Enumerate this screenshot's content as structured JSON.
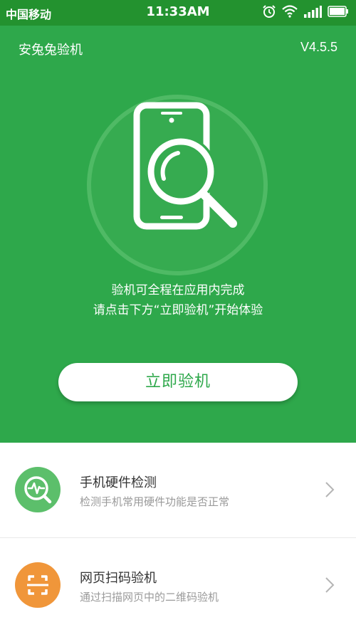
{
  "status_bar": {
    "carrier": "中国移动",
    "time": "11:33AM",
    "icons": [
      "alarm-icon",
      "wifi-icon",
      "signal-icon",
      "battery-icon"
    ]
  },
  "header": {
    "title": "安兔兔验机",
    "version": "V4.5.5"
  },
  "hero": {
    "icon": "phone-search-icon",
    "description_line1": "验机可全程在应用内完成",
    "description_line2": "请点击下方“立即验机”开始体验",
    "cta_label": "立即验机"
  },
  "features": [
    {
      "icon": "hardware-check-icon",
      "title": "手机硬件检测",
      "subtitle": "检测手机常用硬件功能是否正常",
      "color": "#5cbf6b"
    },
    {
      "icon": "scan-code-icon",
      "title": "网页扫码验机",
      "subtitle": "通过扫描网页中的二维码验机",
      "color": "#f0963a"
    }
  ],
  "colors": {
    "status_bar": "#23922f",
    "hero": "#2ea84b",
    "accent": "#2ea84b"
  }
}
